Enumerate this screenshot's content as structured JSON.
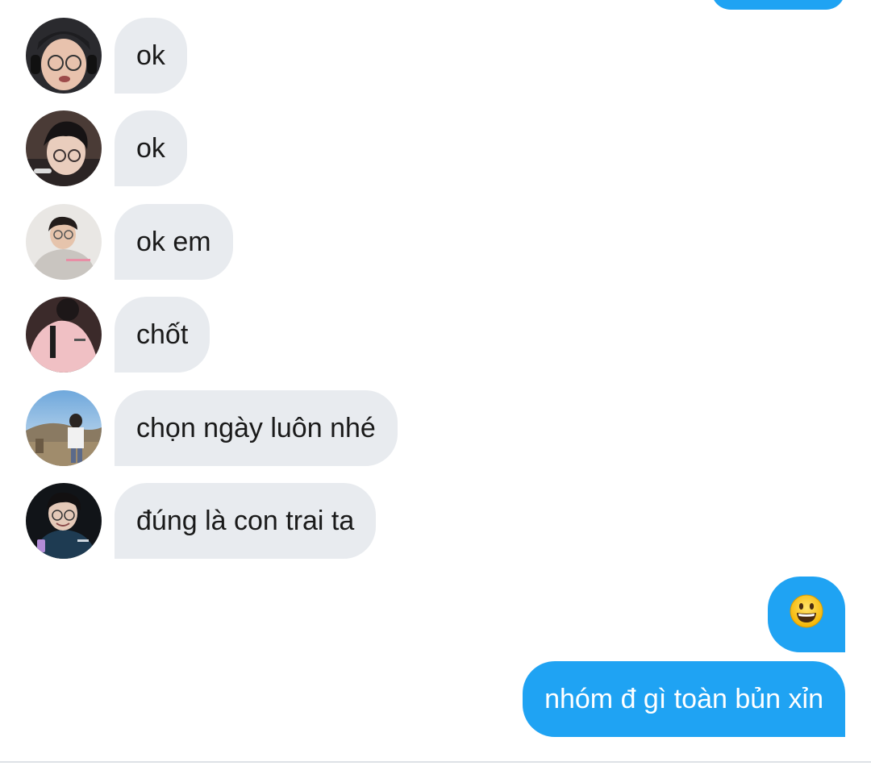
{
  "colors": {
    "incoming_bubble": "#e8ebef",
    "outgoing_bubble": "#1fa3f3",
    "incoming_text": "#1a1a1a",
    "outgoing_text": "#ffffff"
  },
  "messages_incoming": [
    {
      "text": "ok",
      "avatar": "avatar-person-headset-glasses"
    },
    {
      "text": "ok",
      "avatar": "avatar-person-dark-hair-glasses"
    },
    {
      "text": "ok em",
      "avatar": "avatar-person-grey-hoodie"
    },
    {
      "text": "chốt",
      "avatar": "avatar-person-pink-jacket"
    },
    {
      "text": "chọn ngày luôn nhé",
      "avatar": "avatar-person-outdoor-sky"
    },
    {
      "text": "đúng là con trai ta",
      "avatar": "avatar-person-night-jacket"
    }
  ],
  "messages_outgoing": [
    {
      "text": "😃",
      "icon": "smiley-emoji-icon"
    },
    {
      "text": "nhóm đ gì toàn bủn xỉn"
    }
  ]
}
